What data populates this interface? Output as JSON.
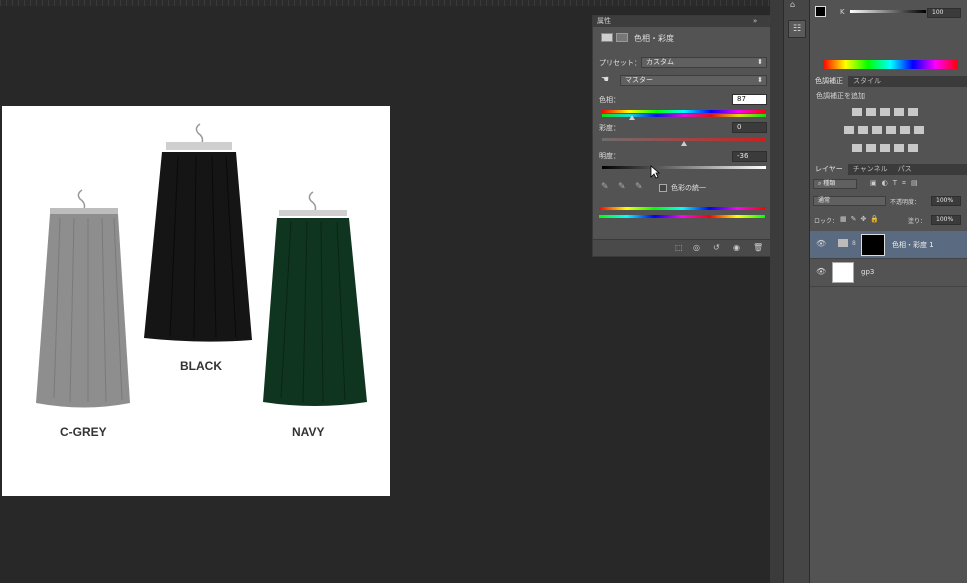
{
  "properties": {
    "panel_title": "属性",
    "adjustment_name": "色相・彩度",
    "preset_label": "プリセット：",
    "preset_value": "カスタム",
    "channel_value": "マスター",
    "hue_label": "色相：",
    "hue_value": "87",
    "saturation_label": "彩度：",
    "saturation_value": "0",
    "lightness_label": "明度：",
    "lightness_value": "-36",
    "colorize_label": "色彩の統一",
    "hue_fraction": 0.18,
    "saturation_fraction": 0.5,
    "lightness_fraction": 0.32
  },
  "document": {
    "items": [
      {
        "label": "C-GREY",
        "color": "#8e8e8e"
      },
      {
        "label": "BLACK",
        "color": "#151515"
      },
      {
        "label": "NAVY",
        "color": "#0f3520"
      }
    ]
  },
  "color_panel": {
    "channel_label": "K",
    "value": "100"
  },
  "adjustments_panel": {
    "tabs": [
      "色調補正",
      "スタイル"
    ],
    "add_label": "色調補正を追加"
  },
  "layers_panel": {
    "tabs": [
      "レイヤー",
      "チャンネル",
      "パス"
    ],
    "kind_label": "種類",
    "blend_mode": "通常",
    "opacity_label": "不透明度：",
    "opacity_value": "100%",
    "lock_label": "ロック：",
    "fill_label": "塗り：",
    "fill_value": "100%",
    "layers": [
      {
        "name": "色相・彩度 1",
        "selected": true
      },
      {
        "name": "gp3",
        "selected": false
      }
    ]
  },
  "colors": {
    "accent_selected": "#5a6a80",
    "panel_bg": "#535353"
  }
}
